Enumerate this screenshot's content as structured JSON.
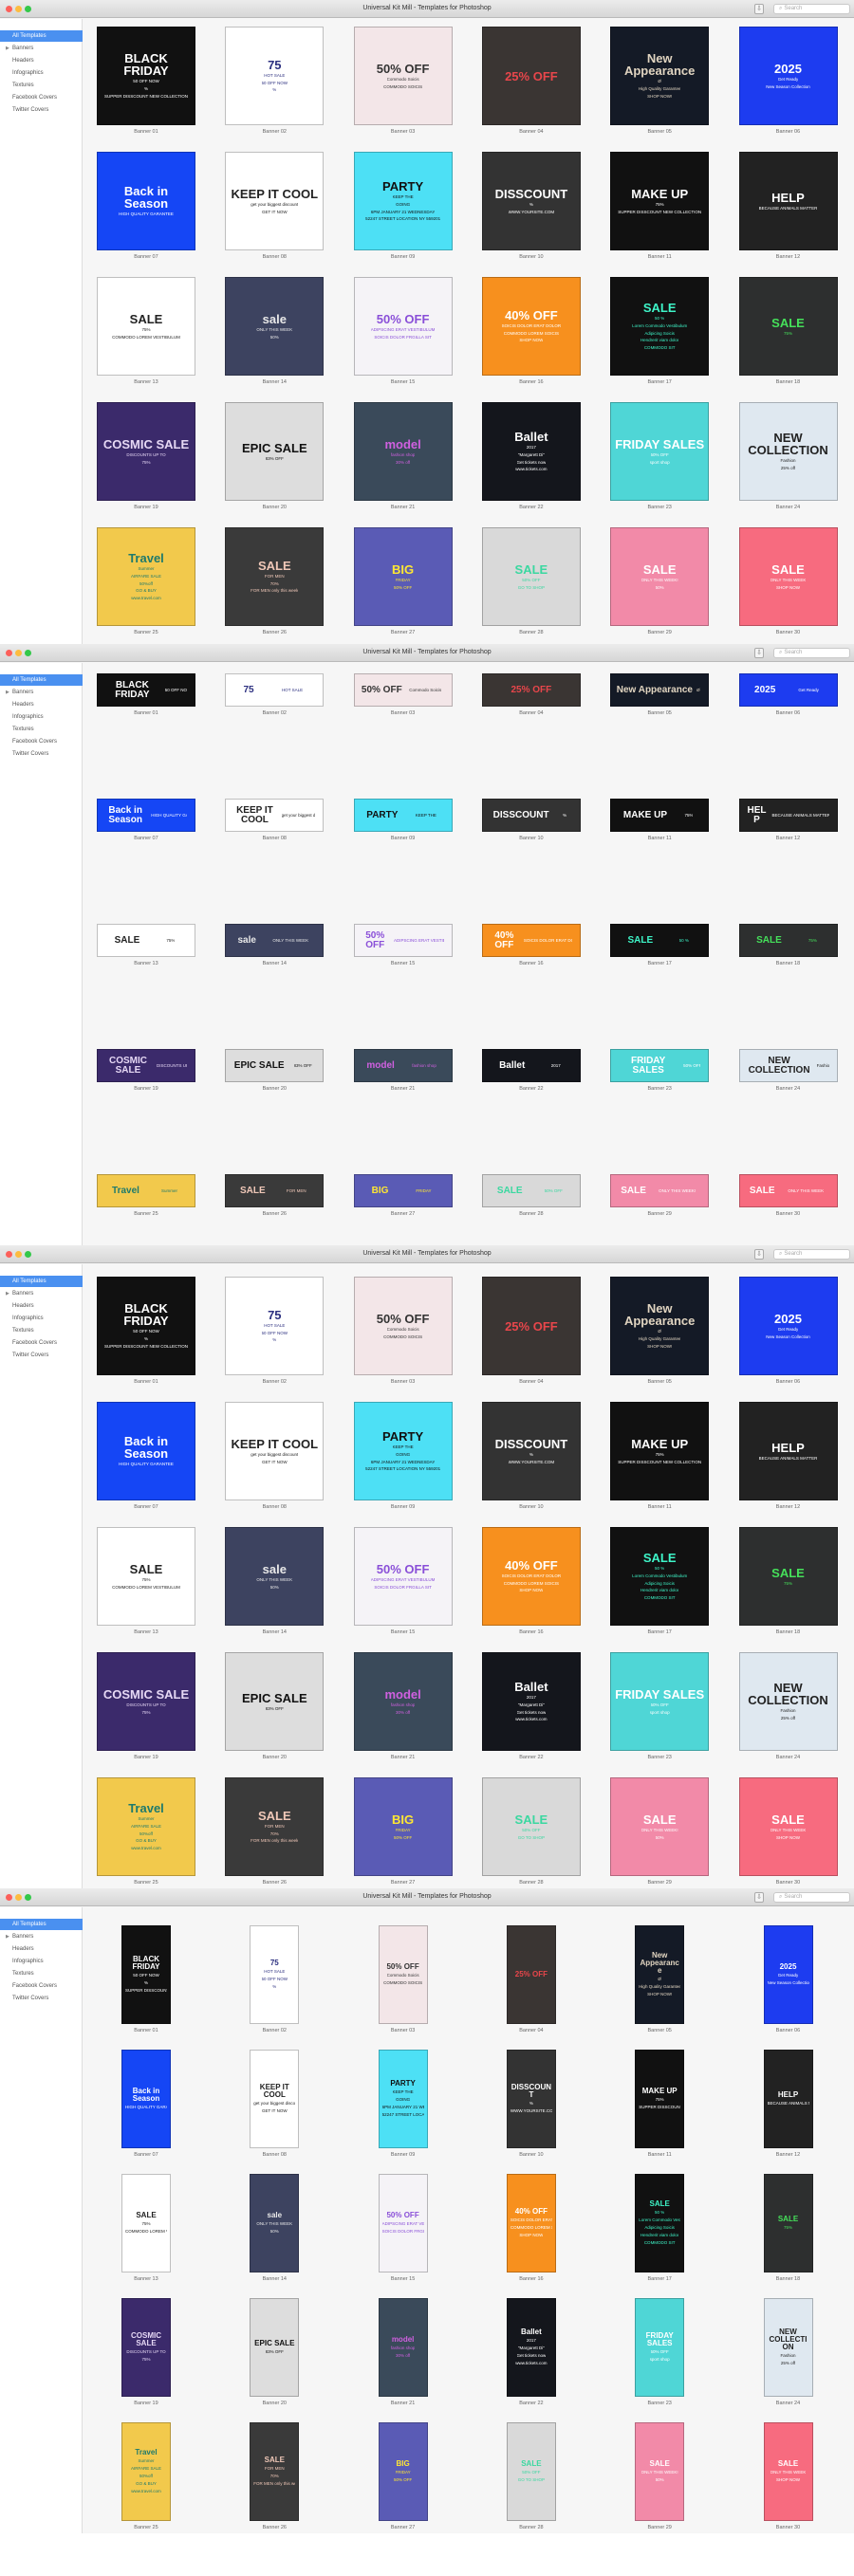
{
  "app": {
    "title": "Universal Kit Mill - Templates for Photoshop",
    "search_placeholder": "Search",
    "download_icon": "download-icon",
    "search_icon": "search-icon",
    "traffic_lights": [
      "#fc605b",
      "#fdbc40",
      "#34c84a"
    ],
    "accent": "#4a90f0"
  },
  "sidebar": {
    "items": [
      {
        "label": "All Templates",
        "selected": true
      },
      {
        "label": "Banners",
        "expandable": true
      },
      {
        "label": "Headers"
      },
      {
        "label": "Infographics"
      },
      {
        "label": "Textures"
      },
      {
        "label": "Facebook Covers"
      },
      {
        "label": "Twitter Covers"
      }
    ]
  },
  "windows": [
    {
      "format": "square"
    },
    {
      "format": "wide"
    },
    {
      "format": "square"
    },
    {
      "format": "tall"
    }
  ],
  "banners": [
    {
      "label": "Banner 01",
      "bg": "#111111",
      "fg": "#ffffff",
      "title": "BLACK FRIDAY",
      "lines": [
        "50 OFF NOW",
        "%",
        "SUPPER DISSCOUNT NEW COLLECTION"
      ]
    },
    {
      "label": "Banner 02",
      "bg": "#ffffff",
      "fg": "#2b2f7f",
      "title": "75",
      "lines": [
        "HOT SALE",
        "50 OFF NOW",
        "%"
      ]
    },
    {
      "label": "Banner 03",
      "bg": "#f3e6e8",
      "fg": "#333333",
      "title": "50% OFF",
      "lines": [
        "Commodo Soicis",
        "COMMODO SOICIS"
      ]
    },
    {
      "label": "Banner 04",
      "bg": "#3a3533",
      "fg": "#e8464b",
      "title": "25% OFF",
      "lines": []
    },
    {
      "label": "Banner 05",
      "bg": "#141a26",
      "fg": "#e0d4c0",
      "title": "New Appearance",
      "lines": [
        "Ø",
        "High Quality Garantee",
        "SHOP NOW!"
      ]
    },
    {
      "label": "Banner 06",
      "bg": "#1d3cf0",
      "fg": "#ffffff",
      "title": "2025",
      "lines": [
        "Get Ready",
        "New Season Collection"
      ]
    },
    {
      "label": "Banner 07",
      "bg": "#1546f5",
      "fg": "#ffffff",
      "title": "Back in Season",
      "lines": [
        "HIGH QUALITY GARANTEE"
      ]
    },
    {
      "label": "Banner 08",
      "bg": "#ffffff",
      "fg": "#222222",
      "title": "KEEP IT COOL",
      "lines": [
        "get your biggest discount",
        "GET IT NOW"
      ]
    },
    {
      "label": "Banner 09",
      "bg": "#4de0f5",
      "fg": "#111111",
      "title": "PARTY",
      "lines": [
        "KEEP THE",
        "GOING",
        "6PM JANUARY 21 WEDNESDAY",
        "52247 STREET LOCATION NY 559201"
      ]
    },
    {
      "label": "Banner 10",
      "bg": "#333333",
      "fg": "#ffffff",
      "title": "DISSCOUNT",
      "lines": [
        "%",
        "WWW.YOURSITE.COM"
      ]
    },
    {
      "label": "Banner 11",
      "bg": "#111111",
      "fg": "#ffffff",
      "title": "MAKE UP",
      "lines": [
        "75%",
        "SUPPER DISSCOUNT NEW COLLECTION"
      ]
    },
    {
      "label": "Banner 12",
      "bg": "#222222",
      "fg": "#ffffff",
      "title": "HELP",
      "lines": [
        "BECAUSE ANIMALS MATTER"
      ]
    },
    {
      "label": "Banner 13",
      "bg": "#ffffff",
      "fg": "#222222",
      "title": "SALE",
      "lines": [
        "75%",
        "COMMODO LOREM VESTIBULUM"
      ]
    },
    {
      "label": "Banner 14",
      "bg": "#3d4360",
      "fg": "#e8e8e8",
      "title": "sale",
      "lines": [
        "ONLY THIS WEEK",
        "50%"
      ]
    },
    {
      "label": "Banner 15",
      "bg": "#f5f3f7",
      "fg": "#8a4fd8",
      "title": "50% OFF",
      "lines": [
        "ADIPSCING ERAT VESTIBULUM",
        "SOICIS DOLOR FRGILLA SIT"
      ]
    },
    {
      "label": "Banner 16",
      "bg": "#f7901e",
      "fg": "#ffffff",
      "title": "40% OFF",
      "lines": [
        "SOICIS DOLOR ERAT DOLOR",
        "COMMODO LOREM SOICIS",
        "SHOP NOW"
      ]
    },
    {
      "label": "Banner 17",
      "bg": "#111111",
      "fg": "#3ef5c8",
      "title": "SALE",
      "lines": [
        "50 %",
        "Lorem Commodo Vestibulum",
        "Adipicing Soicis",
        "Hendrerit viam dolor",
        "COMMODO SIT"
      ]
    },
    {
      "label": "Banner 18",
      "bg": "#2d2f2f",
      "fg": "#45e05a",
      "title": "SALE",
      "lines": [
        "75%"
      ]
    },
    {
      "label": "Banner 19",
      "bg": "#3b2a6b",
      "fg": "#e6d8f5",
      "title": "COSMIC SALE",
      "lines": [
        "DISCOUNTS UP TO",
        "75%"
      ]
    },
    {
      "label": "Banner 20",
      "bg": "#dddddd",
      "fg": "#111111",
      "title": "EPIC SALE",
      "lines": [
        "83% OFF"
      ]
    },
    {
      "label": "Banner 21",
      "bg": "#3a4a5a",
      "fg": "#d060e0",
      "title": "model",
      "lines": [
        "fashion shop",
        "30% off"
      ]
    },
    {
      "label": "Banner 22",
      "bg": "#14161c",
      "fg": "#ffffff",
      "title": "Ballet",
      "lines": [
        "2017",
        "\"Margarett Di\"",
        "Get tickets now",
        "www.tickets.com"
      ]
    },
    {
      "label": "Banner 23",
      "bg": "#4fd6d6",
      "fg": "#ffffff",
      "title": "FRIDAY SALES",
      "lines": [
        "50% OFF",
        "sport shop"
      ]
    },
    {
      "label": "Banner 24",
      "bg": "#dfe8f0",
      "fg": "#222222",
      "title": "NEW COLLECTION",
      "lines": [
        "Fashion",
        "25% off"
      ]
    },
    {
      "label": "Banner 25",
      "bg": "#f2c94c",
      "fg": "#1e7a6c",
      "title": "Travel",
      "lines": [
        "Summer",
        "AIRFARE SALE",
        "50%off",
        "GO & BUY",
        "www.travel.com"
      ]
    },
    {
      "label": "Banner 26",
      "bg": "#3a3a3a",
      "fg": "#f0c8b8",
      "title": "SALE",
      "lines": [
        "FOR MEN",
        "70%",
        "FOR MEN only this week"
      ]
    },
    {
      "label": "Banner 27",
      "bg": "#5a5bb5",
      "fg": "#ffe733",
      "title": "BIG",
      "lines": [
        "FRIDAY",
        "50% OFF"
      ]
    },
    {
      "label": "Banner 28",
      "bg": "#d9d9d9",
      "fg": "#3ad8a0",
      "title": "SALE",
      "lines": [
        "50% OFF",
        "GO TO SHOP"
      ]
    },
    {
      "label": "Banner 29",
      "bg": "#f28aa8",
      "fg": "#ffffff",
      "title": "SALE",
      "lines": [
        "ONLY THIS WEEK!",
        "50%"
      ]
    },
    {
      "label": "Banner 30",
      "bg": "#f76b7f",
      "fg": "#ffffff",
      "title": "SALE",
      "lines": [
        "ONLY THIS WEEK",
        "SHOP NOW"
      ]
    }
  ]
}
